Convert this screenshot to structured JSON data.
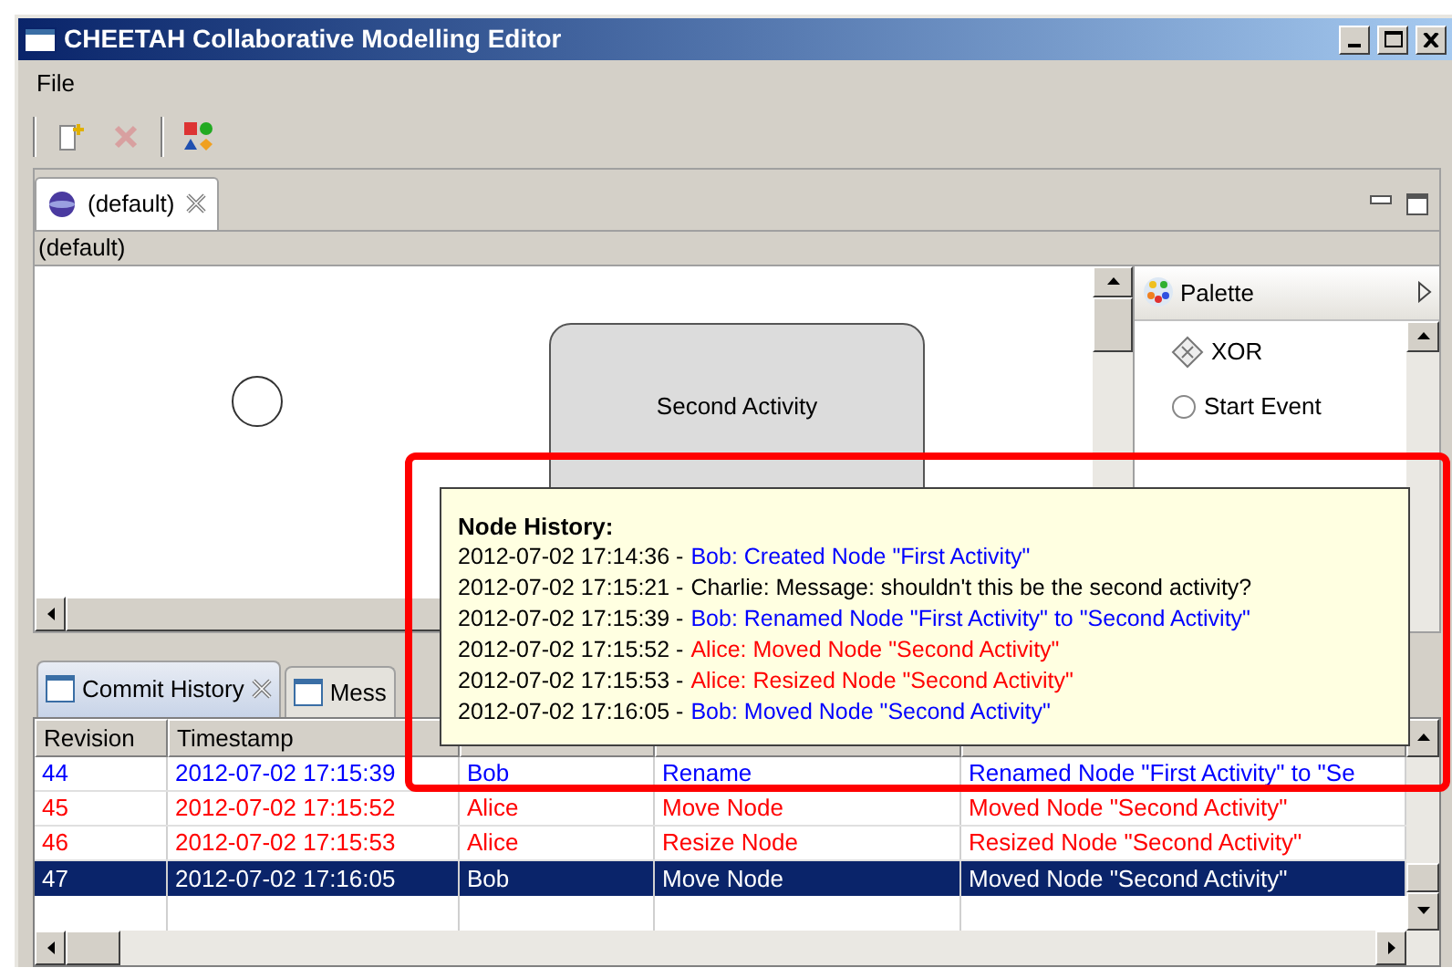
{
  "window": {
    "title": "CHEETAH Collaborative Modelling Editor"
  },
  "menu": [
    "File"
  ],
  "editor": {
    "tabs": [
      {
        "label": "(default)",
        "selected": true
      }
    ],
    "breadcrumb": "(default)",
    "nodes": [
      {
        "kind": "event"
      },
      {
        "kind": "activity",
        "label": "Second Activity"
      }
    ],
    "palette": {
      "title": "Palette",
      "items": [
        {
          "kind": "gateway",
          "label": "XOR"
        },
        {
          "kind": "event",
          "label": "Start Event"
        }
      ]
    }
  },
  "tooltip": {
    "title": "Node History:",
    "entries": [
      {
        "time": "2012-07-02 17:14:36 -",
        "text": "Bob: Created Node \"First Activity\"",
        "color": "#0000ff"
      },
      {
        "time": "2012-07-02 17:15:21 -",
        "text": "Charlie: Message: shouldn't this be the second activity?",
        "color": "#000000"
      },
      {
        "time": "2012-07-02 17:15:39 -",
        "text": "Bob: Renamed Node \"First Activity\" to \"Second Activity\"",
        "color": "#0000ff"
      },
      {
        "time": "2012-07-02 17:15:52 -",
        "text": "Alice: Moved Node \"Second Activity\"",
        "color": "#ff0000"
      },
      {
        "time": "2012-07-02 17:15:53 -",
        "text": "Alice: Resized Node \"Second Activity\"",
        "color": "#ff0000"
      },
      {
        "time": "2012-07-02 17:16:05 -",
        "text": "Bob: Moved Node \"Second Activity\"",
        "color": "#0000ff"
      }
    ]
  },
  "views": {
    "tabs": [
      {
        "label": "Commit History",
        "selected": true,
        "closable": true
      },
      {
        "label": "Mess",
        "selected": false,
        "closable": false
      }
    ]
  },
  "table": {
    "columns": [
      "Revision",
      "Timestamp"
    ],
    "rows": [
      {
        "cells": [
          "44",
          "2012-07-02 17:15:39",
          "Bob",
          "Rename",
          "Renamed Node \"First Activity\" to \"Se"
        ],
        "color": "#0000ff",
        "selected": false
      },
      {
        "cells": [
          "45",
          "2012-07-02 17:15:52",
          "Alice",
          "Move Node",
          "Moved Node \"Second Activity\""
        ],
        "color": "#ff0000",
        "selected": false
      },
      {
        "cells": [
          "46",
          "2012-07-02 17:15:53",
          "Alice",
          "Resize Node",
          "Resized Node \"Second Activity\""
        ],
        "color": "#ff0000",
        "selected": false
      },
      {
        "cells": [
          "47",
          "2012-07-02 17:16:05",
          "Bob",
          "Move Node",
          "Moved Node \"Second Activity\""
        ],
        "selected": true
      }
    ]
  }
}
